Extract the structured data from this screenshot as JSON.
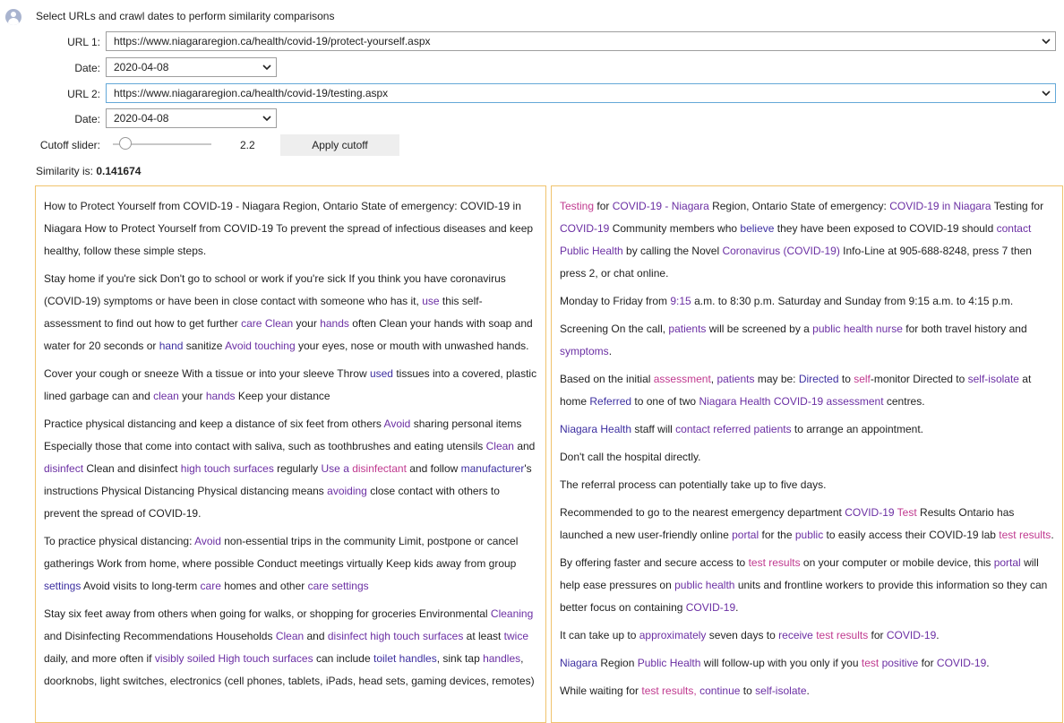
{
  "header": {
    "instruction": "Select URLs and crawl dates to perform similarity comparisons"
  },
  "form": {
    "url1_label": "URL 1:",
    "url1_value": "https://www.niagararegion.ca/health/covid-19/protect-yourself.aspx",
    "date1_label": "Date:",
    "date1_value": "2020-04-08",
    "url2_label": "URL 2:",
    "url2_value": "https://www.niagararegion.ca/health/covid-19/testing.aspx",
    "date2_label": "Date:",
    "date2_value": "2020-04-08",
    "cutoff_label": "Cutoff slider:",
    "cutoff_value": "2.2",
    "cutoff_level": 0.13,
    "apply_label": "Apply cutoff"
  },
  "result": {
    "label": "Similarity is:",
    "value": "0.141674"
  },
  "colors": {
    "panel_border": "#f0c36d",
    "highlight_purple": "#6b2fa3",
    "highlight_magenta": "#c0398f",
    "highlight_indigo": "#3d2fa0"
  },
  "left_panel": [
    "How to Protect Yourself from COVID-19 - Niagara Region, Ontario State of emergency: COVID-19 in Niagara How to Protect Yourself from COVID-19 To prevent the spread of infectious diseases and keep healthy, follow these simple steps.",
    "Stay home if you're sick Don't go to school or work if you're sick If you think you have coronavirus (COVID-19) symptoms or have been in close contact with someone who has it, use this self-assessment to find out how to get further care Clean your hands often Clean your hands with soap and water for 20 seconds or hand sanitize Avoid touching your eyes, nose or mouth with unwashed hands.",
    "Cover your cough or sneeze With a tissue or into your sleeve Throw used tissues into a covered, plastic lined garbage can and clean your hands Keep your distance",
    "Practice physical distancing and keep a distance of six feet from others Avoid sharing personal items Especially those that come into contact with saliva, such as toothbrushes and eating utensils Clean and disinfect Clean and disinfect high touch surfaces regularly Use a disinfectant and follow manufacturer's instructions Physical Distancing Physical distancing means avoiding close contact with others to prevent the spread of COVID-19.",
    "To practice physical distancing: Avoid non-essential trips in the community Limit, postpone or cancel gatherings Work from home, where possible Conduct meetings virtually Keep kids away from group settings Avoid visits to long-term care homes and other care settings",
    "Stay six feet away from others when going for walks, or shopping for groceries Environmental Cleaning and Disinfecting Recommendations Households Clean and disinfect high touch surfaces at least twice daily, and more often if visibly soiled High touch surfaces can include toilet handles, sink tap handles, doorknobs, light switches, electronics (cell phones, tablets, iPads, head sets, gaming devices, remotes)"
  ],
  "right_panel": [
    "Testing for COVID-19 - Niagara Region, Ontario State of emergency: COVID-19 in Niagara Testing for COVID-19 Community members who believe they have been exposed to COVID-19 should contact Public Health by calling the Novel Coronavirus (COVID-19) Info-Line at 905-688-8248, press 7 then press 2, or chat online.",
    "Monday to Friday from 9:15 a.m. to 8:30 p.m. Saturday and Sunday from 9:15 a.m. to 4:15 p.m.",
    "Screening On the call, patients will be screened by a public health nurse for both travel history and symptoms.",
    "Based on the initial assessment, patients may be: Directed to self-monitor Directed to self-isolate at home Referred to one of two Niagara Health COVID-19 assessment centres.",
    "Niagara Health staff will contact referred patients to arrange an appointment.",
    "Don't call the hospital directly.",
    "The referral process can potentially take up to five days.",
    "Recommended to go to the nearest emergency department COVID-19 Test Results Ontario has launched a new user-friendly online portal for the public to easily access their COVID-19 lab test results.",
    "By offering faster and secure access to test results on your computer or mobile device, this portal will help ease pressures on public health units and frontline workers to provide this information so they can better focus on containing COVID-19.",
    "It can take up to approximately seven days to receive test results for COVID-19.",
    "Niagara Region Public Health will follow-up with you only if you test positive for COVID-19.",
    "While waiting for test results, continue to self-isolate."
  ],
  "highlights": {
    "left": [
      [
        "use",
        "a"
      ],
      [
        "care",
        "a"
      ],
      [
        "Clean",
        "a"
      ],
      [
        "hands",
        "a"
      ],
      [
        "hand",
        "c"
      ],
      [
        "Avoid touching",
        "a"
      ],
      [
        "used",
        "c"
      ],
      [
        "clean",
        "a"
      ],
      [
        "Avoid",
        "a"
      ],
      [
        "disinfectant",
        "b"
      ],
      [
        "manufacturer",
        "c"
      ],
      [
        "disinfect",
        "a"
      ],
      [
        "high touch surfaces",
        "a"
      ],
      [
        "Use a",
        "a"
      ],
      [
        "avoiding",
        "a"
      ],
      [
        "settings",
        "c"
      ],
      [
        "care settings",
        "a"
      ],
      [
        "Cleaning",
        "a"
      ],
      [
        "twice",
        "a"
      ],
      [
        "visibly soiled",
        "a"
      ],
      [
        "High touch surfaces",
        "a"
      ],
      [
        "toilet handles",
        "c"
      ],
      [
        "handles",
        "a"
      ]
    ],
    "right": [
      [
        "Testing",
        "b"
      ],
      [
        "COVID-19 - Niagara",
        "a"
      ],
      [
        "COVID-19 in Niagara",
        "a"
      ],
      [
        "COVID-19",
        "a"
      ],
      [
        "believe",
        "c"
      ],
      [
        "contact Public Health",
        "a"
      ],
      [
        "Coronavirus (COVID-19)",
        "a"
      ],
      [
        "9:15",
        "a"
      ],
      [
        "patients",
        "a"
      ],
      [
        "public health nurse",
        "a"
      ],
      [
        "symptoms",
        "a"
      ],
      [
        "assessment",
        "b"
      ],
      [
        "Directed",
        "c"
      ],
      [
        "self",
        "b"
      ],
      [
        "self-isolate",
        "a"
      ],
      [
        "Referred",
        "c"
      ],
      [
        "Niagara Health COVID-19 assessment",
        "a"
      ],
      [
        "Niagara Health",
        "c"
      ],
      [
        "contact referred patients",
        "a"
      ],
      [
        "Test",
        "b"
      ],
      [
        "portal",
        "a"
      ],
      [
        "public",
        "a"
      ],
      [
        "test results",
        "b"
      ],
      [
        "public health",
        "a"
      ],
      [
        "approximately",
        "a"
      ],
      [
        "receive",
        "a"
      ],
      [
        "Niagara",
        "c"
      ],
      [
        "Public Health",
        "a"
      ],
      [
        "test",
        "b"
      ],
      [
        "positive",
        "a"
      ],
      [
        "continue",
        "a"
      ],
      [
        "test results,",
        "b"
      ]
    ]
  }
}
